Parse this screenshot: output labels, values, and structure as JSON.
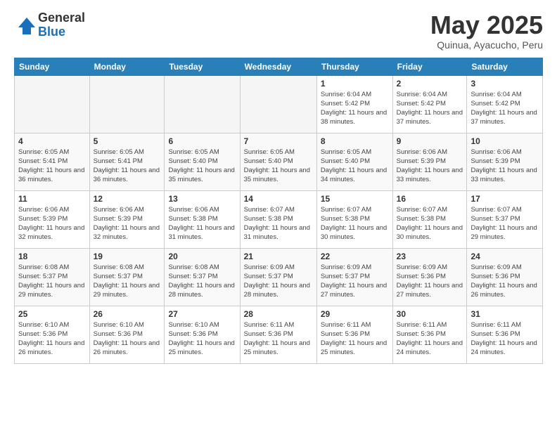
{
  "header": {
    "logo_general": "General",
    "logo_blue": "Blue",
    "month_title": "May 2025",
    "subtitle": "Quinua, Ayacucho, Peru"
  },
  "weekdays": [
    "Sunday",
    "Monday",
    "Tuesday",
    "Wednesday",
    "Thursday",
    "Friday",
    "Saturday"
  ],
  "weeks": [
    [
      {
        "day": "",
        "info": ""
      },
      {
        "day": "",
        "info": ""
      },
      {
        "day": "",
        "info": ""
      },
      {
        "day": "",
        "info": ""
      },
      {
        "day": "1",
        "info": "Sunrise: 6:04 AM\nSunset: 5:42 PM\nDaylight: 11 hours\nand 38 minutes."
      },
      {
        "day": "2",
        "info": "Sunrise: 6:04 AM\nSunset: 5:42 PM\nDaylight: 11 hours\nand 37 minutes."
      },
      {
        "day": "3",
        "info": "Sunrise: 6:04 AM\nSunset: 5:42 PM\nDaylight: 11 hours\nand 37 minutes."
      }
    ],
    [
      {
        "day": "4",
        "info": "Sunrise: 6:05 AM\nSunset: 5:41 PM\nDaylight: 11 hours\nand 36 minutes."
      },
      {
        "day": "5",
        "info": "Sunrise: 6:05 AM\nSunset: 5:41 PM\nDaylight: 11 hours\nand 36 minutes."
      },
      {
        "day": "6",
        "info": "Sunrise: 6:05 AM\nSunset: 5:40 PM\nDaylight: 11 hours\nand 35 minutes."
      },
      {
        "day": "7",
        "info": "Sunrise: 6:05 AM\nSunset: 5:40 PM\nDaylight: 11 hours\nand 35 minutes."
      },
      {
        "day": "8",
        "info": "Sunrise: 6:05 AM\nSunset: 5:40 PM\nDaylight: 11 hours\nand 34 minutes."
      },
      {
        "day": "9",
        "info": "Sunrise: 6:06 AM\nSunset: 5:39 PM\nDaylight: 11 hours\nand 33 minutes."
      },
      {
        "day": "10",
        "info": "Sunrise: 6:06 AM\nSunset: 5:39 PM\nDaylight: 11 hours\nand 33 minutes."
      }
    ],
    [
      {
        "day": "11",
        "info": "Sunrise: 6:06 AM\nSunset: 5:39 PM\nDaylight: 11 hours\nand 32 minutes."
      },
      {
        "day": "12",
        "info": "Sunrise: 6:06 AM\nSunset: 5:39 PM\nDaylight: 11 hours\nand 32 minutes."
      },
      {
        "day": "13",
        "info": "Sunrise: 6:06 AM\nSunset: 5:38 PM\nDaylight: 11 hours\nand 31 minutes."
      },
      {
        "day": "14",
        "info": "Sunrise: 6:07 AM\nSunset: 5:38 PM\nDaylight: 11 hours\nand 31 minutes."
      },
      {
        "day": "15",
        "info": "Sunrise: 6:07 AM\nSunset: 5:38 PM\nDaylight: 11 hours\nand 30 minutes."
      },
      {
        "day": "16",
        "info": "Sunrise: 6:07 AM\nSunset: 5:38 PM\nDaylight: 11 hours\nand 30 minutes."
      },
      {
        "day": "17",
        "info": "Sunrise: 6:07 AM\nSunset: 5:37 PM\nDaylight: 11 hours\nand 29 minutes."
      }
    ],
    [
      {
        "day": "18",
        "info": "Sunrise: 6:08 AM\nSunset: 5:37 PM\nDaylight: 11 hours\nand 29 minutes."
      },
      {
        "day": "19",
        "info": "Sunrise: 6:08 AM\nSunset: 5:37 PM\nDaylight: 11 hours\nand 29 minutes."
      },
      {
        "day": "20",
        "info": "Sunrise: 6:08 AM\nSunset: 5:37 PM\nDaylight: 11 hours\nand 28 minutes."
      },
      {
        "day": "21",
        "info": "Sunrise: 6:09 AM\nSunset: 5:37 PM\nDaylight: 11 hours\nand 28 minutes."
      },
      {
        "day": "22",
        "info": "Sunrise: 6:09 AM\nSunset: 5:37 PM\nDaylight: 11 hours\nand 27 minutes."
      },
      {
        "day": "23",
        "info": "Sunrise: 6:09 AM\nSunset: 5:36 PM\nDaylight: 11 hours\nand 27 minutes."
      },
      {
        "day": "24",
        "info": "Sunrise: 6:09 AM\nSunset: 5:36 PM\nDaylight: 11 hours\nand 26 minutes."
      }
    ],
    [
      {
        "day": "25",
        "info": "Sunrise: 6:10 AM\nSunset: 5:36 PM\nDaylight: 11 hours\nand 26 minutes."
      },
      {
        "day": "26",
        "info": "Sunrise: 6:10 AM\nSunset: 5:36 PM\nDaylight: 11 hours\nand 26 minutes."
      },
      {
        "day": "27",
        "info": "Sunrise: 6:10 AM\nSunset: 5:36 PM\nDaylight: 11 hours\nand 25 minutes."
      },
      {
        "day": "28",
        "info": "Sunrise: 6:11 AM\nSunset: 5:36 PM\nDaylight: 11 hours\nand 25 minutes."
      },
      {
        "day": "29",
        "info": "Sunrise: 6:11 AM\nSunset: 5:36 PM\nDaylight: 11 hours\nand 25 minutes."
      },
      {
        "day": "30",
        "info": "Sunrise: 6:11 AM\nSunset: 5:36 PM\nDaylight: 11 hours\nand 24 minutes."
      },
      {
        "day": "31",
        "info": "Sunrise: 6:11 AM\nSunset: 5:36 PM\nDaylight: 11 hours\nand 24 minutes."
      }
    ]
  ]
}
